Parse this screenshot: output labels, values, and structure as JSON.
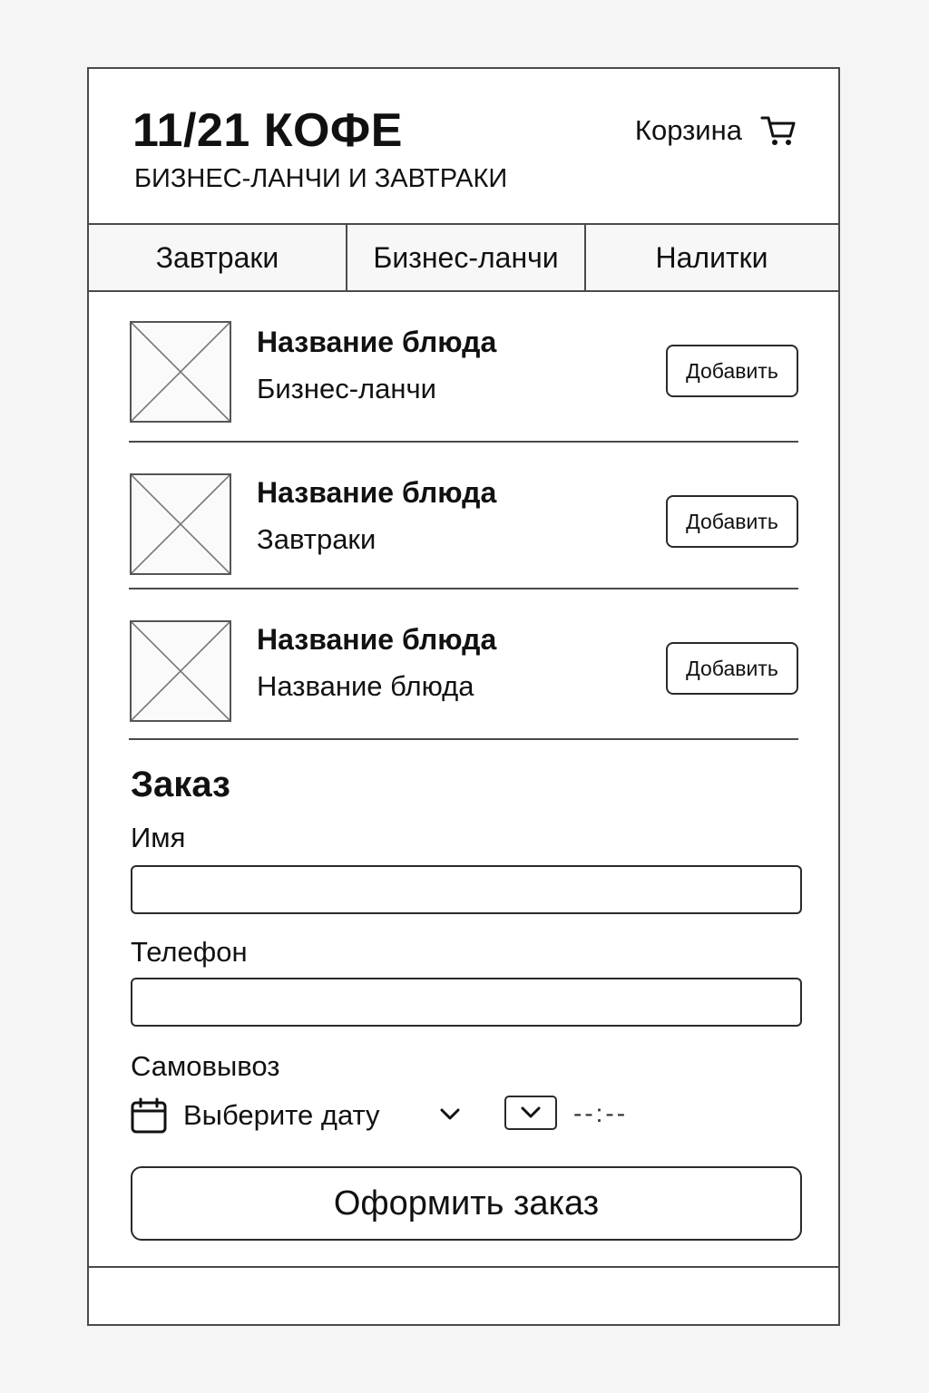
{
  "header": {
    "title": "11/21 КОФЕ",
    "subtitle": "БИЗНЕС-ЛАНЧИ И ЗАВТРАКИ",
    "cart_label": "Корзина",
    "cart_icon": "cart-icon"
  },
  "tabs": [
    {
      "label": "Завтраки"
    },
    {
      "label": "Бизнес-ланчи"
    },
    {
      "label": "Налитки"
    }
  ],
  "menu": {
    "items": [
      {
        "name": "Название блюда",
        "category": "Бизнес-ланчи",
        "add_label": "Добавить",
        "image_icon": "image-placeholder-icon"
      },
      {
        "name": "Название блюда",
        "category": "Завтраки",
        "add_label": "Добавить",
        "image_icon": "image-placeholder-icon"
      },
      {
        "name": "Название блюда",
        "category": "Название блюда",
        "add_label": "Добавить",
        "image_icon": "image-placeholder-icon"
      }
    ]
  },
  "order": {
    "title": "Заказ",
    "name_label": "Имя",
    "name_value": "",
    "phone_label": "Телефон",
    "phone_value": "",
    "pickup_label": "Самовывоз",
    "date_placeholder": "Выберите дату",
    "time_value": "--:--",
    "submit_label": "Оформить заказ",
    "calendar_icon": "calendar-icon",
    "chevron_icon": "chevron-down-icon"
  }
}
